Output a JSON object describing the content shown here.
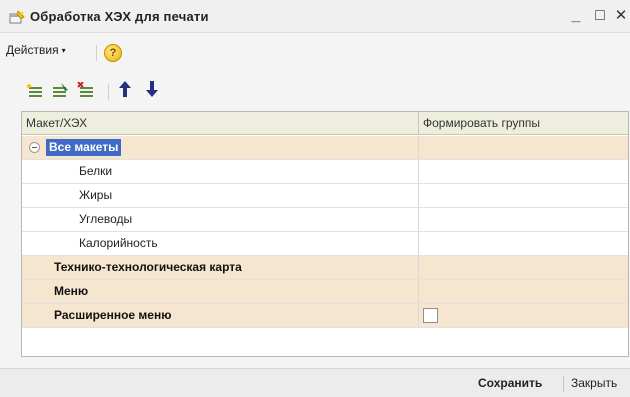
{
  "window": {
    "title": "Обработка  ХЭХ для печати",
    "icon": "form-edit-icon",
    "controls": {
      "minimize": "_",
      "maximize": "□",
      "close": "✕"
    }
  },
  "menubar": {
    "actions_label": "Действия",
    "actions_caret": "▾",
    "help_label": "?"
  },
  "toolbar": {
    "buttons": [
      "add-row-icon",
      "add-subrow-icon",
      "delete-row-icon"
    ],
    "move_up": "🡅",
    "move_down": "🡇"
  },
  "grid": {
    "columns": [
      "Макет/ХЭХ",
      "Формировать группы"
    ],
    "rows": [
      {
        "label": "Все макеты",
        "level": 0,
        "group": true,
        "expanded": true,
        "selected": true
      },
      {
        "label": "Белки",
        "level": 1,
        "group": false
      },
      {
        "label": "Жиры",
        "level": 1,
        "group": false
      },
      {
        "label": "Углеводы",
        "level": 1,
        "group": false
      },
      {
        "label": "Калорийность",
        "level": 1,
        "group": false
      },
      {
        "label": "Технико-технологическая карта",
        "level": 0,
        "group": true
      },
      {
        "label": "Меню",
        "level": 0,
        "group": true
      },
      {
        "label": "Расширенное меню",
        "level": 0,
        "group": true,
        "checkbox": false
      }
    ]
  },
  "footer": {
    "save_label": "Сохранить",
    "close_label": "Закрыть"
  },
  "colors": {
    "group_row_bg": "#f7e6cf",
    "selection_bg": "#3f6bc6",
    "header_bg": "#eeeede"
  }
}
